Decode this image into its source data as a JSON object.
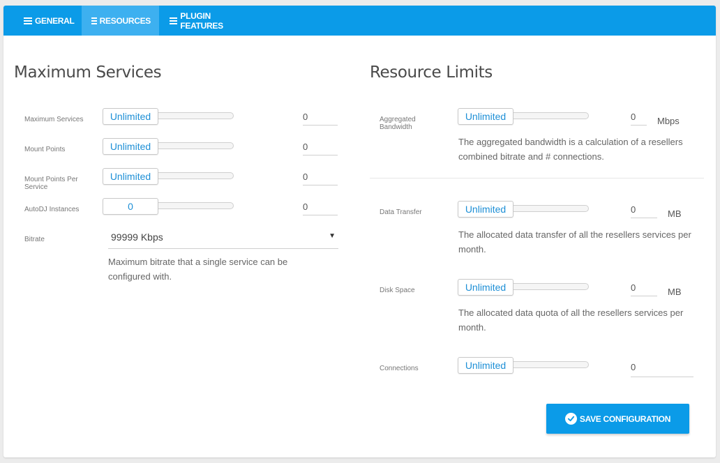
{
  "tabs": [
    {
      "label": "GENERAL",
      "active": false
    },
    {
      "label": "RESOURCES",
      "active": true
    },
    {
      "label": "PLUGIN FEATURES",
      "active": false
    }
  ],
  "left": {
    "title": "Maximum Services",
    "rows": [
      {
        "label": "Maximum Services",
        "slider": "Unlimited",
        "value": "0"
      },
      {
        "label": "Mount Points",
        "slider": "Unlimited",
        "value": "0"
      },
      {
        "label": "Mount Points Per Service",
        "slider": "Unlimited",
        "value": "0"
      },
      {
        "label": "AutoDJ Instances",
        "slider": "0",
        "value": "0"
      }
    ],
    "bitrate": {
      "label": "Bitrate",
      "selected": "99999 Kbps",
      "help": "Maximum bitrate that a single service can be configured with."
    }
  },
  "right": {
    "title": "Resource Limits",
    "rows": [
      {
        "label": "Aggregated Bandwidth",
        "slider": "Unlimited",
        "value": "0",
        "unit": "Mbps",
        "help": "The aggregated bandwidth is a calculation of a resellers combined bitrate and # connections."
      },
      {
        "label": "Data Transfer",
        "slider": "Unlimited",
        "value": "0",
        "unit": "MB",
        "help": "The allocated data transfer of all the resellers services per month."
      },
      {
        "label": "Disk Space",
        "slider": "Unlimited",
        "value": "0",
        "unit": "MB",
        "help": "The allocated data quota of all the resellers services per month."
      },
      {
        "label": "Connections",
        "slider": "Unlimited",
        "value": "0"
      }
    ]
  },
  "save_button": {
    "label": "SAVE CONFIGURATION"
  },
  "colors": {
    "accent": "#0b9be8",
    "tab_active": "#3db0f0",
    "slider_text": "#1d8fd6"
  }
}
